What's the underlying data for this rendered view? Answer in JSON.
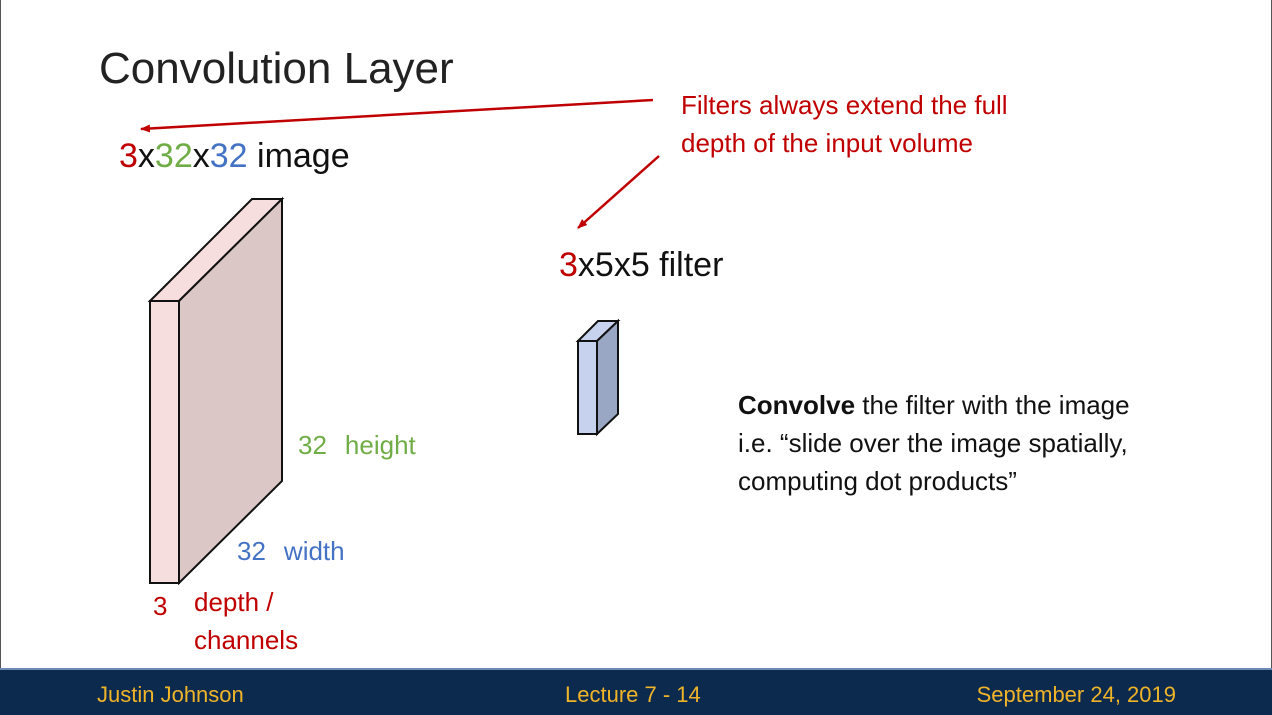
{
  "slide": {
    "title": "Convolution Layer",
    "image_label": {
      "depth": "3",
      "x1": "x",
      "height": "32",
      "x2": "x",
      "width": "32",
      "rest": " image"
    },
    "filter_label": {
      "depth": "3",
      "rest": "x5x5 filter"
    },
    "callout": {
      "line1": "Filters always extend the full",
      "line2": "depth of the input volume"
    },
    "dims": {
      "height_num": "32",
      "height_label": "height",
      "width_num": "32",
      "width_label": "width",
      "depth_num": "3",
      "depth_label_1": "depth /",
      "depth_label_2": "channels"
    },
    "description": {
      "bold": "Convolve",
      "line1_rest": " the filter with the image",
      "line2": "i.e. “slide over the image spatially,",
      "line3": "computing dot products”"
    }
  },
  "footer": {
    "author": "Justin Johnson",
    "lecture": "Lecture 7 - 14",
    "date": "September 24, 2019"
  },
  "colors": {
    "red": "#c00000",
    "green": "#70ad47",
    "blue": "#4472c4",
    "footer_bg": "#0b2a4e",
    "footer_text": "#f0b429"
  }
}
